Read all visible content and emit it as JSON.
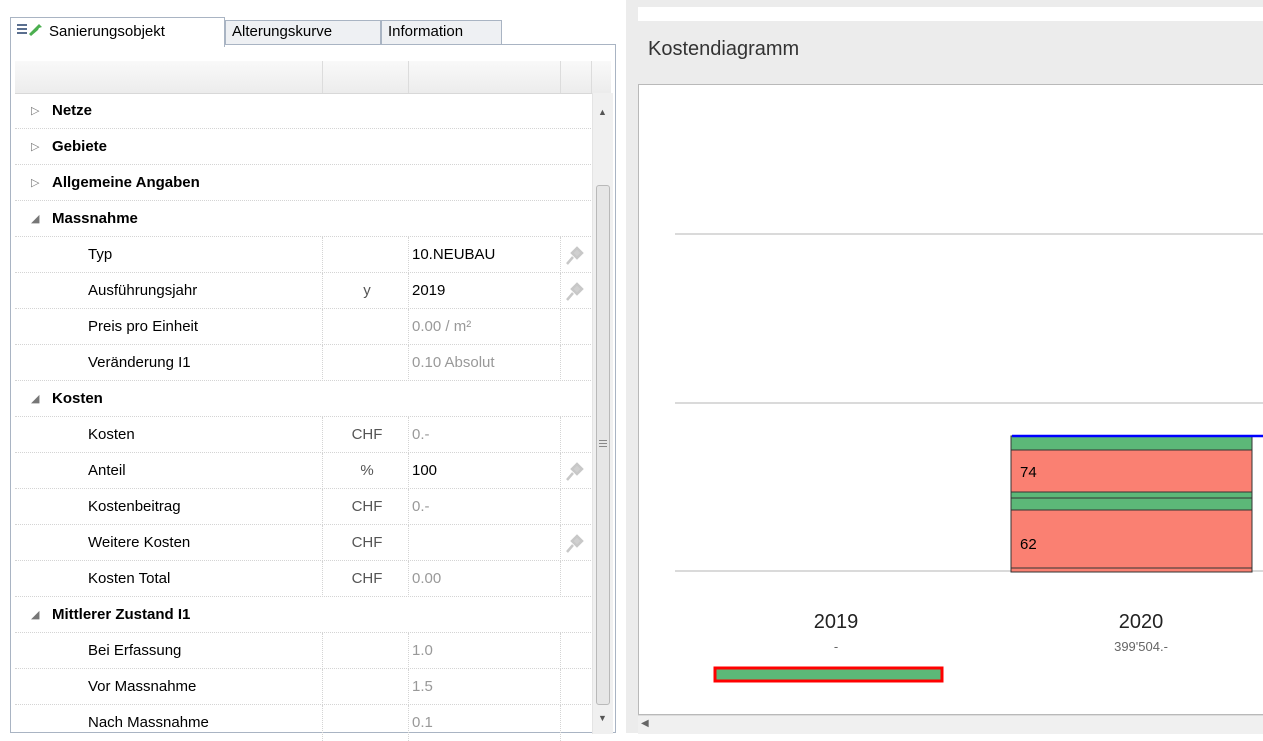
{
  "tabs": [
    {
      "label": "Sanierungsobjekt",
      "active": true
    },
    {
      "label": "Alterungskurve",
      "active": false
    },
    {
      "label": "Information",
      "active": false
    }
  ],
  "grid": {
    "categories_collapsed": [
      "Netze",
      "Gebiete",
      "Allgemeine Angaben"
    ],
    "massnahme": {
      "label": "Massnahme",
      "rows": [
        {
          "name": "Typ",
          "unit": "",
          "value": "10.NEUBAU",
          "editable": true
        },
        {
          "name": "Ausführungsjahr",
          "unit": "y",
          "value": "2019",
          "editable": true
        },
        {
          "name": "Preis pro Einheit",
          "unit": "",
          "value": "0.00 / m²",
          "editable": false
        },
        {
          "name": "Veränderung I1",
          "unit": "",
          "value": "0.10 Absolut",
          "editable": false
        }
      ]
    },
    "kosten": {
      "label": "Kosten",
      "rows": [
        {
          "name": "Kosten",
          "unit": "CHF",
          "value": "0.-",
          "editable": false
        },
        {
          "name": "Anteil",
          "unit": "%",
          "value": "100",
          "editable": true
        },
        {
          "name": "Kostenbeitrag",
          "unit": "CHF",
          "value": "0.-",
          "editable": false
        },
        {
          "name": "Weitere Kosten",
          "unit": "CHF",
          "value": "",
          "editable": true
        },
        {
          "name": "Kosten Total",
          "unit": "CHF",
          "value": "0.00",
          "editable": false
        }
      ]
    },
    "zustand": {
      "label": "Mittlerer Zustand I1",
      "rows": [
        {
          "name": "Bei Erfassung",
          "unit": "",
          "value": "1.0",
          "editable": false
        },
        {
          "name": "Vor Massnahme",
          "unit": "",
          "value": "1.5",
          "editable": false
        },
        {
          "name": "Nach Massnahme",
          "unit": "",
          "value": "0.1",
          "editable": false
        }
      ]
    }
  },
  "diagram": {
    "title": "Kostendiagramm",
    "years": [
      {
        "year": "2019",
        "amount": "-"
      },
      {
        "year": "2020",
        "amount": "399'504.-"
      }
    ],
    "segment_labels": [
      "74",
      "62"
    ]
  },
  "colors": {
    "salmon": "#fa8072",
    "green": "#5cb878",
    "blue": "#0000ff",
    "red": "#ff0000"
  }
}
